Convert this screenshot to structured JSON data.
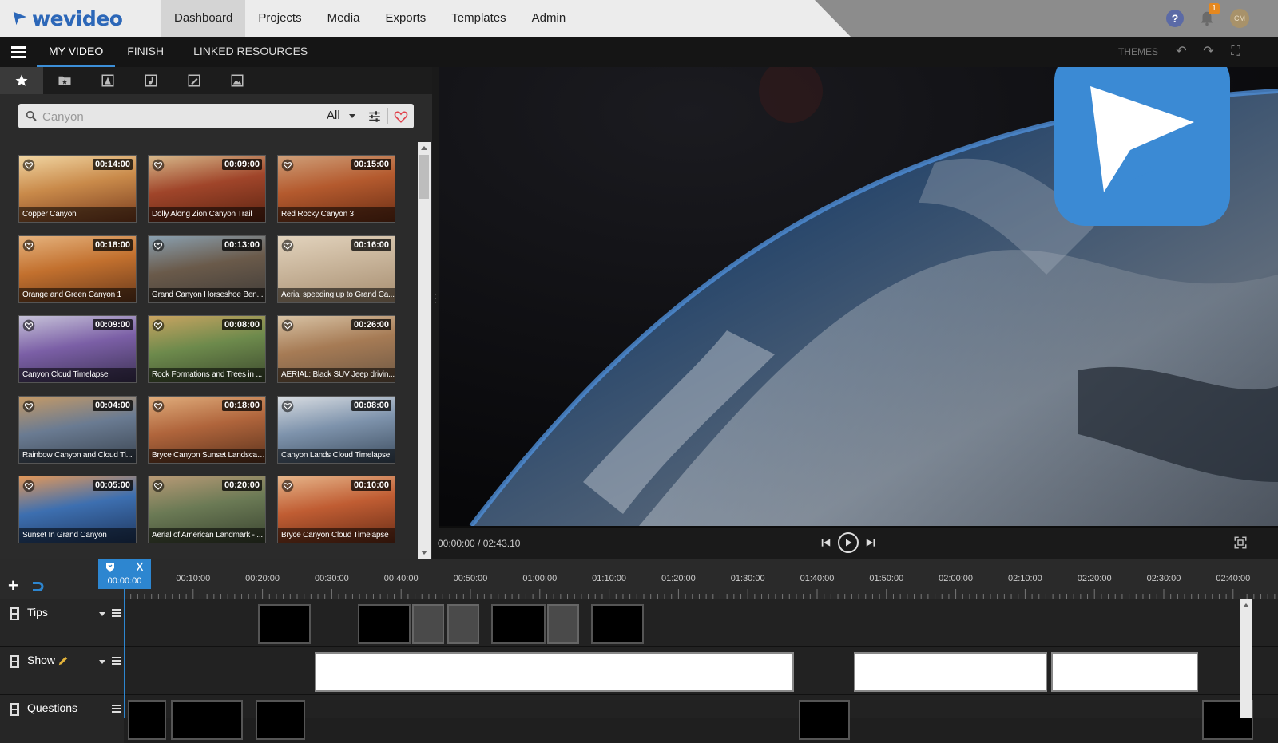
{
  "app": {
    "brand": "wevideo",
    "nav": [
      "Dashboard",
      "Projects",
      "Media",
      "Exports",
      "Templates",
      "Admin"
    ],
    "active_nav": "Dashboard",
    "notification_count": "1",
    "avatar_initials": "CM",
    "help_glyph": "?"
  },
  "editor": {
    "tabs": [
      "MY VIDEO",
      "FINISH",
      "LINKED RESOURCES"
    ],
    "active_tab": "MY VIDEO",
    "themes_label": "THEMES"
  },
  "library": {
    "tab_icons": [
      "star-icon",
      "folder-star-icon",
      "stock-image-icon",
      "stock-audio-icon",
      "edit-image-icon",
      "gallery-icon"
    ],
    "search": {
      "placeholder": "Canyon",
      "filter_value": "All"
    },
    "items": [
      {
        "title": "Copper Canyon",
        "duration": "00:14:00"
      },
      {
        "title": "Dolly Along Zion Canyon Trail",
        "duration": "00:09:00"
      },
      {
        "title": "Red Rocky Canyon 3",
        "duration": "00:15:00"
      },
      {
        "title": "Orange and Green Canyon 1",
        "duration": "00:18:00"
      },
      {
        "title": "Grand Canyon Horseshoe Ben...",
        "duration": "00:13:00"
      },
      {
        "title": "Aerial speeding up to Grand Ca...",
        "duration": "00:16:00"
      },
      {
        "title": "Canyon Cloud Timelapse",
        "duration": "00:09:00"
      },
      {
        "title": "Rock Formations and Trees in ...",
        "duration": "00:08:00"
      },
      {
        "title": "AERIAL: Black SUV Jeep drivin...",
        "duration": "00:26:00"
      },
      {
        "title": "Rainbow Canyon and Cloud Ti...",
        "duration": "00:04:00"
      },
      {
        "title": "Bryce Canyon Sunset Landscape",
        "duration": "00:18:00"
      },
      {
        "title": "Canyon Lands Cloud Timelapse",
        "duration": "00:08:00"
      },
      {
        "title": "Sunset In Grand Canyon",
        "duration": "00:05:00"
      },
      {
        "title": "Aerial of American Landmark - ...",
        "duration": "00:20:00"
      },
      {
        "title": "Bryce Canyon Cloud Timelapse",
        "duration": "00:10:00"
      }
    ]
  },
  "preview": {
    "timecode": "00:00:00 / 02:43.10"
  },
  "timeline": {
    "playhead_time": "00:00:00",
    "ticks": [
      "00:10:00",
      "00:20:00",
      "00:30:00",
      "00:40:00",
      "00:50:00",
      "01:00:00",
      "01:10:00",
      "01:20:00",
      "01:30:00",
      "01:40:00",
      "01:50:00",
      "02:00:00",
      "02:10:00",
      "02:20:00",
      "02:30:00",
      "02:40:00"
    ],
    "tracks": [
      {
        "name": "Tips"
      },
      {
        "name": "Show"
      },
      {
        "name": "Questions"
      }
    ]
  }
}
